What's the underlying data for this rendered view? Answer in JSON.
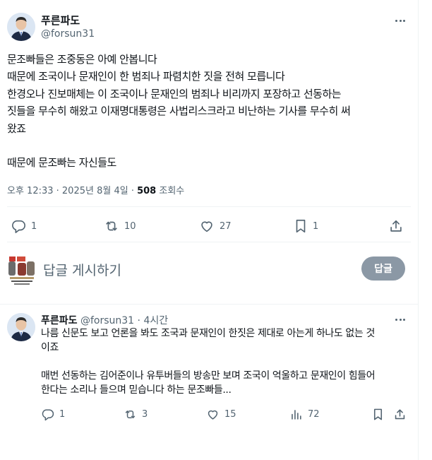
{
  "main_post": {
    "author_name": "푸른파도",
    "author_handle": "@forsun31",
    "text": "문조빠들은 조중동은 아예 안봅니다\n때문에 조국이나 문재인이 한 범죄나 파렴치한 짓을 전혀 모릅니다\n한경오나 진보매체는 이 조국이나 문재인의 범죄나 비리까지 포장하고 선동하는\n짓들을 무수히 해왔고 이재명대통령은 사법리스크라고 비난하는 기사를 무수히 써\n왔죠\n\n때문에 문조빠는 자신들도",
    "timestamp": "오후 12:33 · 2025년 8월 4일 · ",
    "views": "508",
    "views_label": " 조회수",
    "stats": {
      "replies": "1",
      "reposts": "10",
      "likes": "27",
      "bookmarks": "1"
    }
  },
  "reply_composer": {
    "placeholder": "답글 게시하기",
    "button_label": "답글"
  },
  "reply": {
    "author_name": "푸른파도",
    "author_handle": "@forsun31",
    "separator": " · ",
    "time": "4시간",
    "text": "나름 신문도 보고 언론을 봐도 조국과 문재인이 한짓은 제대로 아는게 하나도 없는 것\n이죠\n\n매번 선동하는 김어준이나 유투버들의 방송만 보며 조국이 억울하고 문재인이 힘들어\n한다는 소리나 들으며 믿습니다 하는 문조빠들...",
    "stats": {
      "replies": "1",
      "reposts": "3",
      "likes": "15",
      "views": "72"
    }
  },
  "colors": {
    "text": "#0f1419",
    "secondary": "#536471",
    "divider": "#eff3f4",
    "reply_button": "#8b98a5"
  }
}
